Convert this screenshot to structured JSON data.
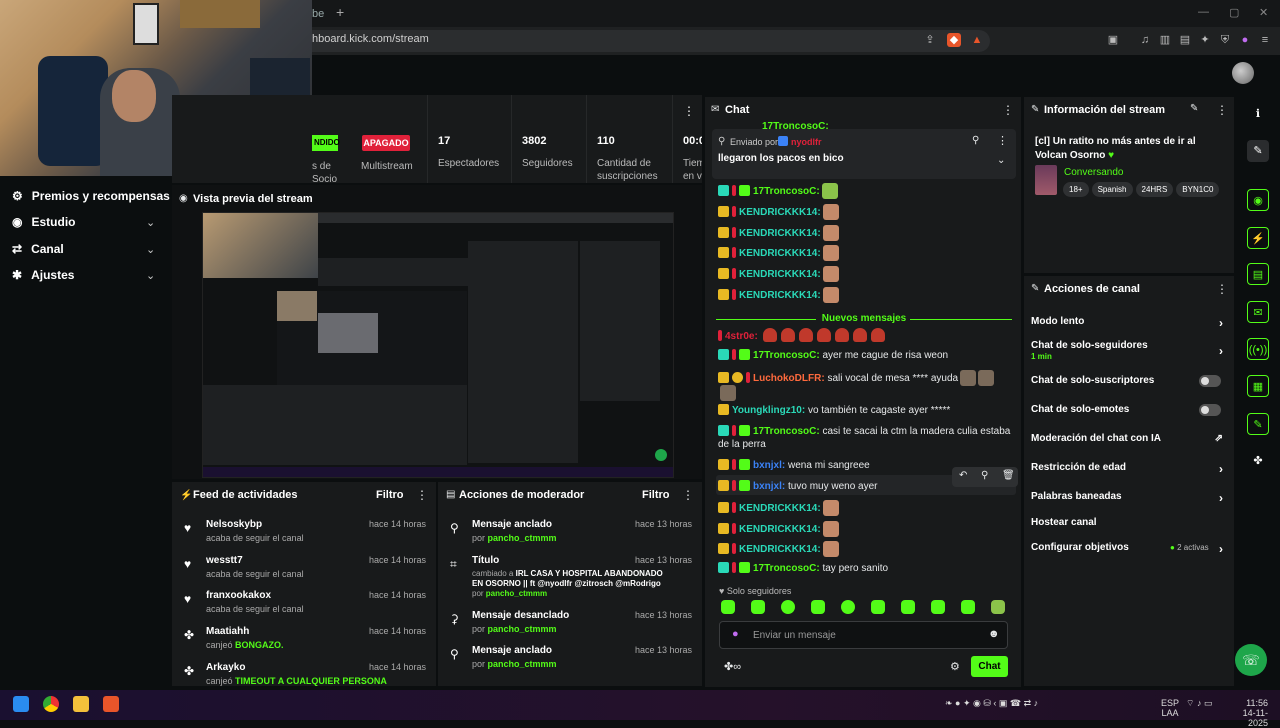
{
  "browser": {
    "tab_fragment": "be",
    "new_tab": "+",
    "url": "hboard.kick.com/stream"
  },
  "sidebar": {
    "items": [
      {
        "label": "Premios y recompensas",
        "icon": "rewards-icon"
      },
      {
        "label": "Estudio",
        "icon": "studio-icon"
      },
      {
        "label": "Canal",
        "icon": "channel-icon"
      },
      {
        "label": "Ajustes",
        "icon": "settings-icon"
      }
    ]
  },
  "stats": {
    "status_live": "NDIDO",
    "socio_label": "s de\nSocio",
    "multistream_badge": "APAGADO",
    "multistream_label": "Multistream",
    "viewers": "17",
    "viewers_label": "Espectadores",
    "followers": "3802",
    "followers_label": "Seguidores",
    "subs": "110",
    "subs_label": "Cantidad de\nsuscripciones",
    "time": "00:0",
    "time_label": "Tiem\nen vi"
  },
  "preview": {
    "title": "Vista previa del stream"
  },
  "feed": {
    "title": "Feed de actividades",
    "filter": "Filtro",
    "items": [
      {
        "name": "Nelsoskybp",
        "sub": "acaba de seguir el canal",
        "time": "hace 14 horas",
        "highlight": ""
      },
      {
        "name": "wesstt7",
        "sub": "acaba de seguir el canal",
        "time": "hace 14 horas",
        "highlight": ""
      },
      {
        "name": "franxookakox",
        "sub": "acaba de seguir el canal",
        "time": "hace 14 horas",
        "highlight": ""
      },
      {
        "name": "Maatiahh",
        "sub": "canjeó ",
        "time": "hace 14 horas",
        "highlight": "BONGAZO."
      },
      {
        "name": "Arkayko",
        "sub": "canjeó ",
        "time": "hace 14 horas",
        "highlight": "TIMEOUT A CUALQUIER PERSONA"
      }
    ]
  },
  "mod": {
    "title": "Acciones de moderador",
    "filter": "Filtro",
    "items": [
      {
        "title": "Mensaje anclado",
        "by": "por ",
        "user": "pancho_ctmmm",
        "time": "hace 13 horas"
      },
      {
        "title": "Título",
        "by": "cambiado a ",
        "detail": "IRL CASA Y HOSPITAL ABANDONADO EN OSORNO || ft @nyodlfr @zitrosch @mRodrigo",
        "by2": " por ",
        "user": "pancho_ctmmm",
        "time": "hace 13 horas"
      },
      {
        "title": "Mensaje desanclado",
        "by": "por ",
        "user": "pancho_ctmmm",
        "time": "hace 13 horas"
      },
      {
        "title": "Mensaje anclado",
        "by": "por ",
        "user": "pancho_ctmmm",
        "time": "hace 13 horas"
      }
    ]
  },
  "chat": {
    "title": "Chat",
    "top_cut_user": "17TroncosoC:",
    "pinned_by": "Enviado por",
    "pinned_user": "nyodlfr",
    "pinned_text": "llegaron los pacos en bico",
    "new_messages": "Nuevos mensajes",
    "messages": [
      {
        "user": "17TroncosoC:",
        "text": "",
        "color": "#53fc18"
      },
      {
        "user": "KENDRICKKK14:",
        "text": "",
        "color": "#2ad9b8"
      },
      {
        "user": "KENDRICKKK14:",
        "text": "",
        "color": "#2ad9b8"
      },
      {
        "user": "KENDRICKKK14:",
        "text": "",
        "color": "#2ad9b8"
      },
      {
        "user": "KENDRICKKK14:",
        "text": "",
        "color": "#2ad9b8"
      },
      {
        "user": "KENDRICKKK14:",
        "text": "",
        "color": "#2ad9b8"
      },
      {
        "user": "4str0e:",
        "text": "",
        "color": "#e0213a"
      },
      {
        "user": "17TroncosoC:",
        "text": "ayer me cague de risa weon",
        "color": "#53fc18"
      },
      {
        "user": "LuchokoDLFR:",
        "text": "sali vocal de mesa **** ayuda",
        "color": "#ff6a3d"
      },
      {
        "user": "Youngklingz10:",
        "text": "vo también te cagaste ayer *****",
        "color": "#2ad9b8"
      },
      {
        "user": "17TroncosoC:",
        "text": "casi te sacai la ctm la madera culia estaba",
        "text2": "de la perra",
        "color": "#53fc18"
      },
      {
        "user": "bxnjxl:",
        "text": "wena mi sangreee",
        "color": "#3b82f6"
      },
      {
        "user": "bxnjxl:",
        "text": "tuvo muy weno ayer",
        "color": "#3b82f6"
      },
      {
        "user": "KENDRICKKK14:",
        "text": "",
        "color": "#2ad9b8"
      },
      {
        "user": "KENDRICKKK14:",
        "text": "",
        "color": "#2ad9b8"
      },
      {
        "user": "KENDRICKKK14:",
        "text": "",
        "color": "#2ad9b8"
      },
      {
        "user": "17TroncosoC:",
        "text": "tay pero sanito",
        "color": "#53fc18"
      }
    ],
    "followers_only": "Solo seguidores",
    "input_placeholder": "Enviar un mensaje",
    "send": "Chat"
  },
  "info": {
    "title": "Información del stream",
    "stream_title": "[cl] Un ratito no más antes de ir al Volcan Osorno",
    "category": "Conversando",
    "tags": [
      "18+",
      "Spanish",
      "24HRS",
      "BYN1C0"
    ]
  },
  "actions": {
    "title": "Acciones de canal",
    "rows": [
      {
        "label": "Modo lento",
        "kind": "arrow"
      },
      {
        "label": "Chat de solo-seguidores",
        "sub": "1 min",
        "kind": "arrow"
      },
      {
        "label": "Chat de solo-suscriptores",
        "kind": "toggle"
      },
      {
        "label": "Chat de solo-emotes",
        "kind": "toggle"
      },
      {
        "label": "Moderación del chat con IA",
        "kind": "external"
      },
      {
        "label": "Restricción de edad",
        "kind": "arrow"
      },
      {
        "label": "Palabras baneadas",
        "kind": "arrow"
      },
      {
        "label": "Hostear canal",
        "kind": "none"
      },
      {
        "label": "Configurar objetivos",
        "extra": "2 activas",
        "kind": "arrow"
      }
    ]
  },
  "taskbar": {
    "lang": "ESP",
    "lang2": "LAA",
    "time": "11:56",
    "date": "14-11-2025"
  },
  "colors": {
    "accent": "#53fc18",
    "danger": "#e0213a",
    "panel": "#181a1b",
    "bg": "#0b0e0f"
  }
}
